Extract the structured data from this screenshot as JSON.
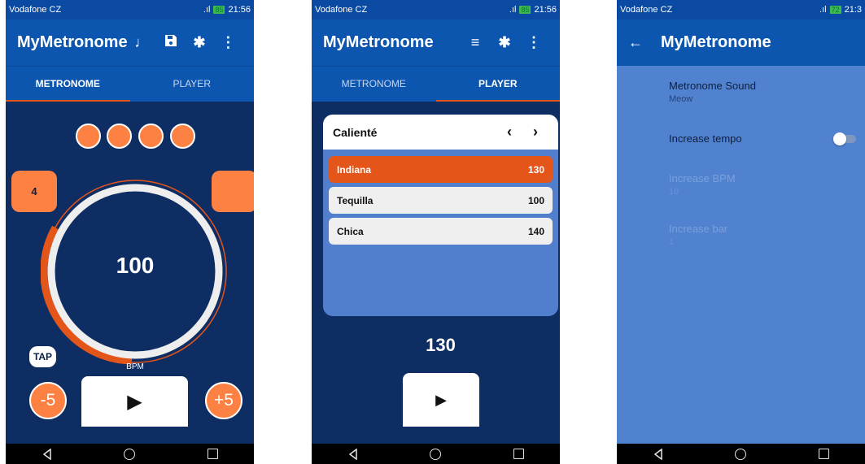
{
  "screen1": {
    "status": {
      "carrier": "Vodafone CZ",
      "time": "21:56",
      "battery": "85"
    },
    "appbar": {
      "title": "MyMetronome",
      "icons": [
        "music-note-icon",
        "save-icon",
        "bluetooth-icon",
        "more-icon"
      ]
    },
    "tabs": [
      {
        "label": "METRONOME",
        "active": true
      },
      {
        "label": "PLAYER",
        "active": false
      }
    ],
    "beats": 4,
    "beats_per_bar": "4",
    "bpm": "100",
    "bpm_label": "BPM",
    "tap_label": "TAP",
    "minus_label": "-5",
    "plus_label": "+5",
    "play_label": "▶"
  },
  "screen2": {
    "status": {
      "carrier": "Vodafone CZ",
      "time": "21:56",
      "battery": "85"
    },
    "appbar": {
      "title": "MyMetronome",
      "icons": [
        "playlist-icon",
        "bluetooth-icon",
        "more-icon"
      ]
    },
    "tabs": [
      {
        "label": "METRONOME",
        "active": false
      },
      {
        "label": "PLAYER",
        "active": true
      }
    ],
    "playlist": {
      "title": "Calienté",
      "prev": "‹",
      "next": "›",
      "songs": [
        {
          "name": "Indiana",
          "bpm": "130",
          "active": true
        },
        {
          "name": "Tequilla",
          "bpm": "100",
          "active": false
        },
        {
          "name": "Chica",
          "bpm": "140",
          "active": false
        }
      ]
    },
    "bpm": "130",
    "play_label": "▶"
  },
  "screen3": {
    "status": {
      "carrier": "Vodafone CZ",
      "time": "21:3",
      "battery": "72"
    },
    "appbar": {
      "title": "MyMetronome",
      "back": "←"
    },
    "prefs": [
      {
        "title": "Metronome Sound",
        "summary": "Meow",
        "enabled": true
      },
      {
        "title": "Increase tempo",
        "summary": "",
        "enabled": true,
        "toggle": false
      },
      {
        "title": "Increase BPM",
        "summary": "10",
        "enabled": false
      },
      {
        "title": "Increase bar",
        "summary": "1",
        "enabled": false
      }
    ]
  },
  "colors": {
    "primary": "#0c56b0",
    "background": "#0e2d63",
    "accent": "#e4551a",
    "beat": "#fd8142",
    "settings_bg": "#5182cf"
  }
}
